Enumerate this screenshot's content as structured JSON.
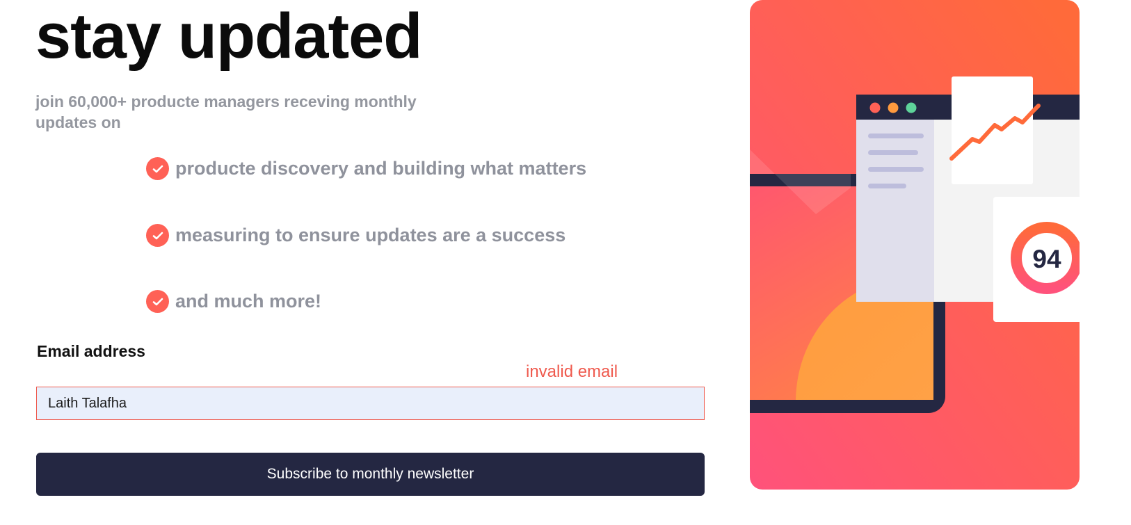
{
  "heading": "stay updated",
  "intro": "join 60,000+ producte managers receving monthly updates on",
  "features": [
    "producte discovery and building what matters",
    "measuring to ensure updates are a success",
    "and much more!"
  ],
  "form": {
    "label": "Email address",
    "error": "invalid email",
    "value": "Laith Talafha",
    "button": "Subscribe to monthly newsletter"
  },
  "illustration": {
    "score": "94"
  },
  "colors": {
    "accent": "#ff6156",
    "dark": "#242742",
    "muted": "#94979f",
    "error": "#ef5a4e",
    "input_bg": "#e9effb"
  }
}
